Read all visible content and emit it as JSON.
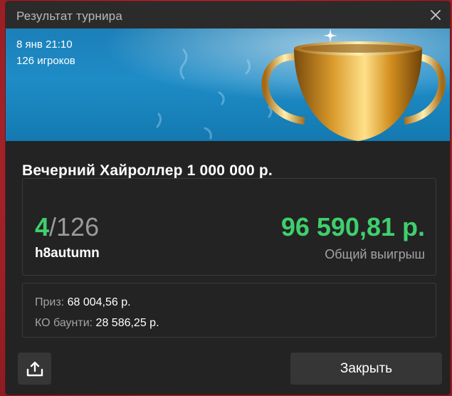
{
  "dialog": {
    "title": "Результат турнира",
    "close_icon": "close-icon"
  },
  "banner": {
    "date": "8 янв 21:10",
    "players": "126 игроков",
    "image": "trophy-cup-illustration"
  },
  "tournament": {
    "name": "Вечерний Хайроллер 1 000 000 р."
  },
  "result": {
    "place": "4",
    "total": "/126",
    "player": "h8autumn",
    "winnings": "96 590,81 р.",
    "winnings_label": "Общий выигрыш"
  },
  "breakdown": {
    "prize_label": "Приз:",
    "prize_value": "68 004,56 р.",
    "bounty_label": "КО баунти:",
    "bounty_value": "28 586,25 р."
  },
  "actions": {
    "share_icon": "share-upload-icon",
    "close_label": "Закрыть"
  },
  "colors": {
    "accent_green": "#3fcf6d",
    "dialog_bg": "#232323",
    "banner_blue": "#1e8cc7",
    "backdrop_red": "#b3262a"
  }
}
